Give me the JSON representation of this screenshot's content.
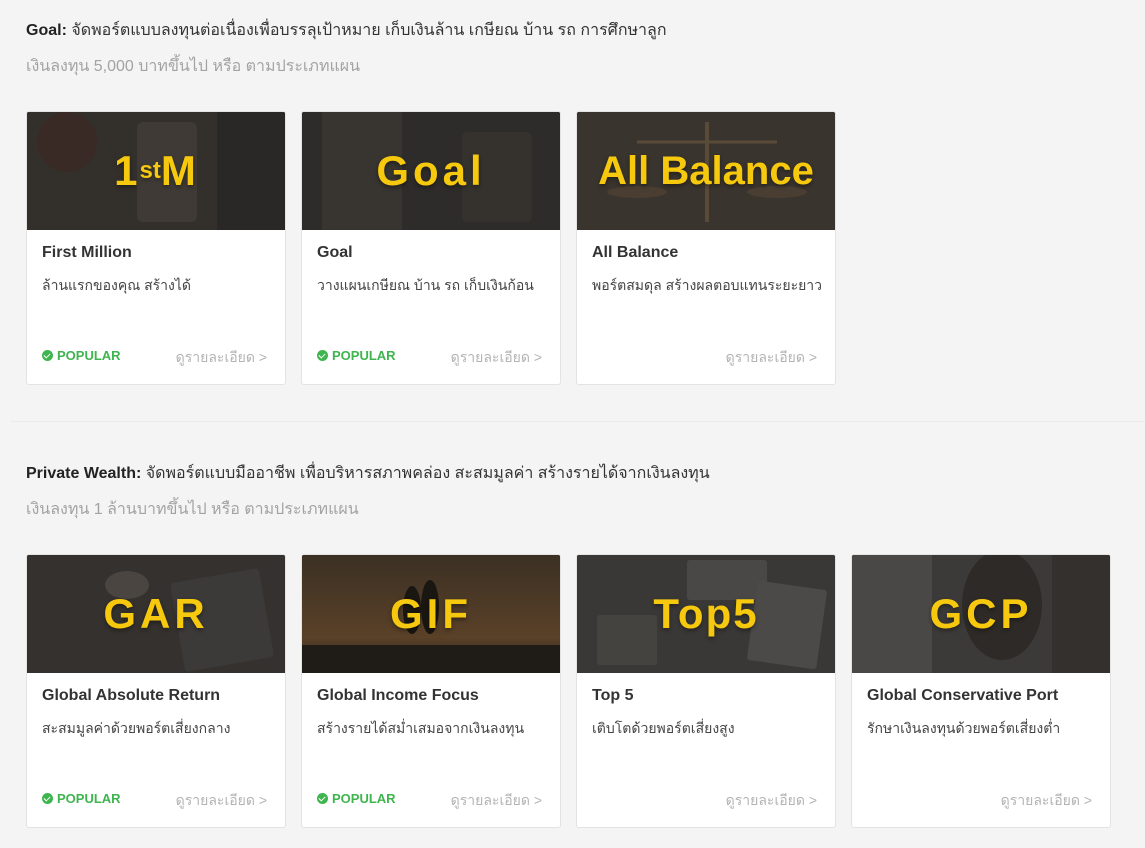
{
  "goal_section": {
    "headline_bold": "Goal:",
    "headline_text": " จัดพอร์ตแบบลงทุนต่อเนื่องเพื่อบรรลุเป้าหมาย เก็บเงินล้าน เกษียณ บ้าน รถ การศึกษาลูก",
    "subline": "เงินลงทุน 5,000 บาทขึ้นไป หรือ ตามประเภทแผน",
    "cards": [
      {
        "code": "1stM",
        "title": "First Million",
        "desc": "ล้านแรกของคุณ สร้างได้",
        "badge": "POPULAR",
        "link": "ดูรายละเอียด >"
      },
      {
        "code": "Goal",
        "title": "Goal",
        "desc": "วางแผนเกษียณ บ้าน รถ เก็บเงินก้อน",
        "badge": "POPULAR",
        "link": "ดูรายละเอียด >"
      },
      {
        "code": "All Balance",
        "title": "All Balance",
        "desc": "พอร์ตสมดุล สร้างผลตอบแทนระยะยาว",
        "badge": "",
        "link": "ดูรายละเอียด >"
      }
    ]
  },
  "wealth_section": {
    "headline_bold": "Private Wealth:",
    "headline_text": " จัดพอร์ตแบบมืออาชีพ เพื่อบริหารสภาพคล่อง สะสมมูลค่า สร้างรายได้จากเงินลงทุน",
    "subline": "เงินลงทุน 1 ล้านบาทขึ้นไป หรือ ตามประเภทแผน",
    "cards": [
      {
        "code": "GAR",
        "title": "Global Absolute Return",
        "desc": "สะสมมูลค่าด้วยพอร์ตเสี่ยงกลาง",
        "badge": "POPULAR",
        "link": "ดูรายละเอียด >"
      },
      {
        "code": "GIF",
        "title": "Global Income Focus",
        "desc": "สร้างรายได้สม่ำเสมอจากเงินลงทุน",
        "badge": "POPULAR",
        "link": "ดูรายละเอียด >"
      },
      {
        "code": "Top5",
        "title": "Top 5",
        "desc": "เติบโตด้วยพอร์ตเสี่ยงสูง",
        "badge": "",
        "link": "ดูรายละเอียด >"
      },
      {
        "code": "GCP",
        "title": "Global Conservative Port",
        "desc": "รักษาเงินลงทุนด้วยพอร์ตเสี่ยงต่ำ",
        "badge": "",
        "link": "ดูรายละเอียด >"
      }
    ]
  },
  "colors": {
    "accent_yellow": "#f6c90e",
    "popular_green": "#3fb54f",
    "link_gray": "#b3b3b3"
  }
}
